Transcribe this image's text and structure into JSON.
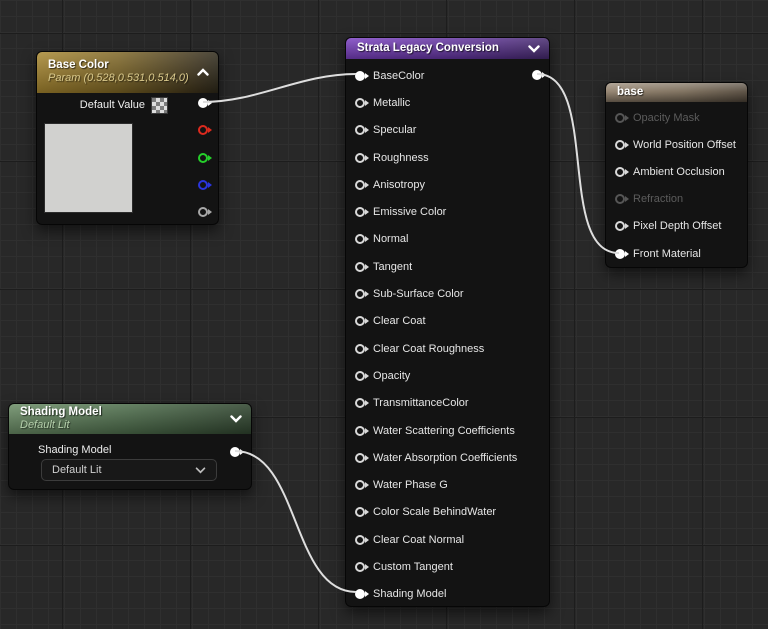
{
  "nodes": {
    "baseColor": {
      "title": "Base Color",
      "subtitle": "Param (0.528,0.531,0.514,0)",
      "defaultValueLabel": "Default Value",
      "headerColor": "#a8872f",
      "previewColor": "#d1d1cf",
      "outputs": [
        "main",
        "red-channel",
        "green-channel",
        "blue-channel",
        "alpha-channel"
      ]
    },
    "strata": {
      "title": "Strata Legacy Conversion",
      "headerColor": "#6b38ad",
      "inputs": [
        "BaseColor",
        "Metallic",
        "Specular",
        "Roughness",
        "Anisotropy",
        "Emissive Color",
        "Normal",
        "Tangent",
        "Sub-Surface Color",
        "Clear Coat",
        "Clear Coat Roughness",
        "Opacity",
        "TransmittanceColor",
        "Water Scattering Coefficients",
        "Water Absorption Coefficients",
        "Water Phase G",
        "Color Scale BehindWater",
        "Clear Coat Normal",
        "Custom Tangent",
        "Shading Model"
      ]
    },
    "base": {
      "title": "base",
      "headerColor": "#92816d",
      "inputs": [
        "Opacity Mask",
        "World Position Offset",
        "Ambient Occlusion",
        "Refraction",
        "Pixel Depth Offset",
        "Front Material"
      ]
    },
    "shadingModel": {
      "title": "Shading Model",
      "subtitle": "Default Lit",
      "fieldLabel": "Shading Model",
      "dropdownValue": "Default Lit",
      "headerColor": "#5e805c"
    }
  },
  "pinColors": {
    "red": "#dc2a1e",
    "green": "#25cf2a",
    "blue": "#2a35dd",
    "alpha": "#a8a8a8",
    "wire": "#dedede"
  }
}
